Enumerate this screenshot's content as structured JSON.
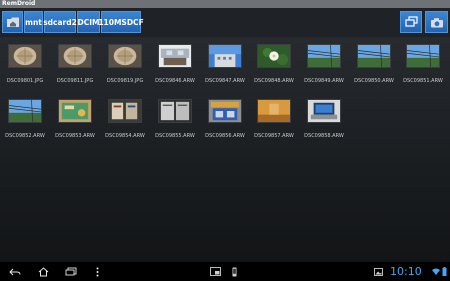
{
  "app": {
    "title": "RemDroid"
  },
  "breadcrumb": {
    "home_icon": "folder-home-icon",
    "segments": [
      "mnt",
      "sdcard2",
      "DCIM",
      "110MSDCF"
    ]
  },
  "toolbar": {
    "windows_icon": "multi-window-icon",
    "camera_icon": "camera-icon"
  },
  "files": [
    {
      "name": "DSC09801.JPG",
      "thumb": "basket"
    },
    {
      "name": "DSC09811.JPG",
      "thumb": "basket"
    },
    {
      "name": "DSC09819.JPG",
      "thumb": "basket"
    },
    {
      "name": "DSC09846.ARW",
      "thumb": "store"
    },
    {
      "name": "DSC09847.ARW",
      "thumb": "sky-building"
    },
    {
      "name": "DSC09848.ARW",
      "thumb": "white-flower"
    },
    {
      "name": "DSC09849.ARW",
      "thumb": "sky-wires"
    },
    {
      "name": "DSC09850.ARW",
      "thumb": "sky-wires"
    },
    {
      "name": "DSC09851.ARW",
      "thumb": "sky-wires"
    },
    {
      "name": "DSC09852.ARW",
      "thumb": "sky-wires"
    },
    {
      "name": "DSC09853.ARW",
      "thumb": "green-card"
    },
    {
      "name": "DSC09854.ARW",
      "thumb": "signs"
    },
    {
      "name": "DSC09855.ARW",
      "thumb": "panels"
    },
    {
      "name": "DSC09856.ARW",
      "thumb": "store-blue"
    },
    {
      "name": "DSC09857.ARW",
      "thumb": "orange"
    },
    {
      "name": "DSC09858.ARW",
      "thumb": "laptop"
    }
  ],
  "statusbar": {
    "time": "10:10"
  },
  "colors": {
    "accent": "#2a6fc0",
    "clock": "#3fa9f5"
  }
}
